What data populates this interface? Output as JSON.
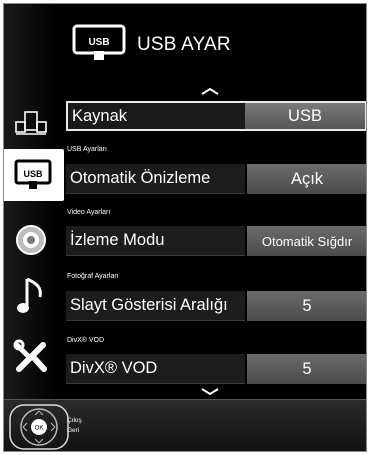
{
  "header": {
    "title": "USB AYAR",
    "logo_text": "USB"
  },
  "sidebar": {
    "items": [
      {
        "name": "sources",
        "icon": "sources-icon"
      },
      {
        "name": "usb",
        "icon": "usb-icon",
        "label": "USB"
      },
      {
        "name": "picture",
        "icon": "picture-icon"
      },
      {
        "name": "sound",
        "icon": "music-note-icon"
      },
      {
        "name": "settings",
        "icon": "tools-icon"
      }
    ]
  },
  "sections": {
    "usb": "USB Ayarları",
    "video": "Video Ayarları",
    "photo": "Fotoğraf Ayarları",
    "divx": "DivX® VOD"
  },
  "rows": [
    {
      "label": "Kaynak",
      "value": "USB"
    },
    {
      "label": "Otomatik Önizleme",
      "value": "Açık"
    },
    {
      "label": "İzleme Modu",
      "value": "Otomatik Sığdır"
    },
    {
      "label": "Slayt Gösterisi Aralığı",
      "value": "5"
    },
    {
      "label": "DivX® VOD",
      "value": "5"
    }
  ],
  "footer": {
    "ok_label": "OK",
    "exit_label": "Çıkış",
    "back_label": "Geri"
  }
}
